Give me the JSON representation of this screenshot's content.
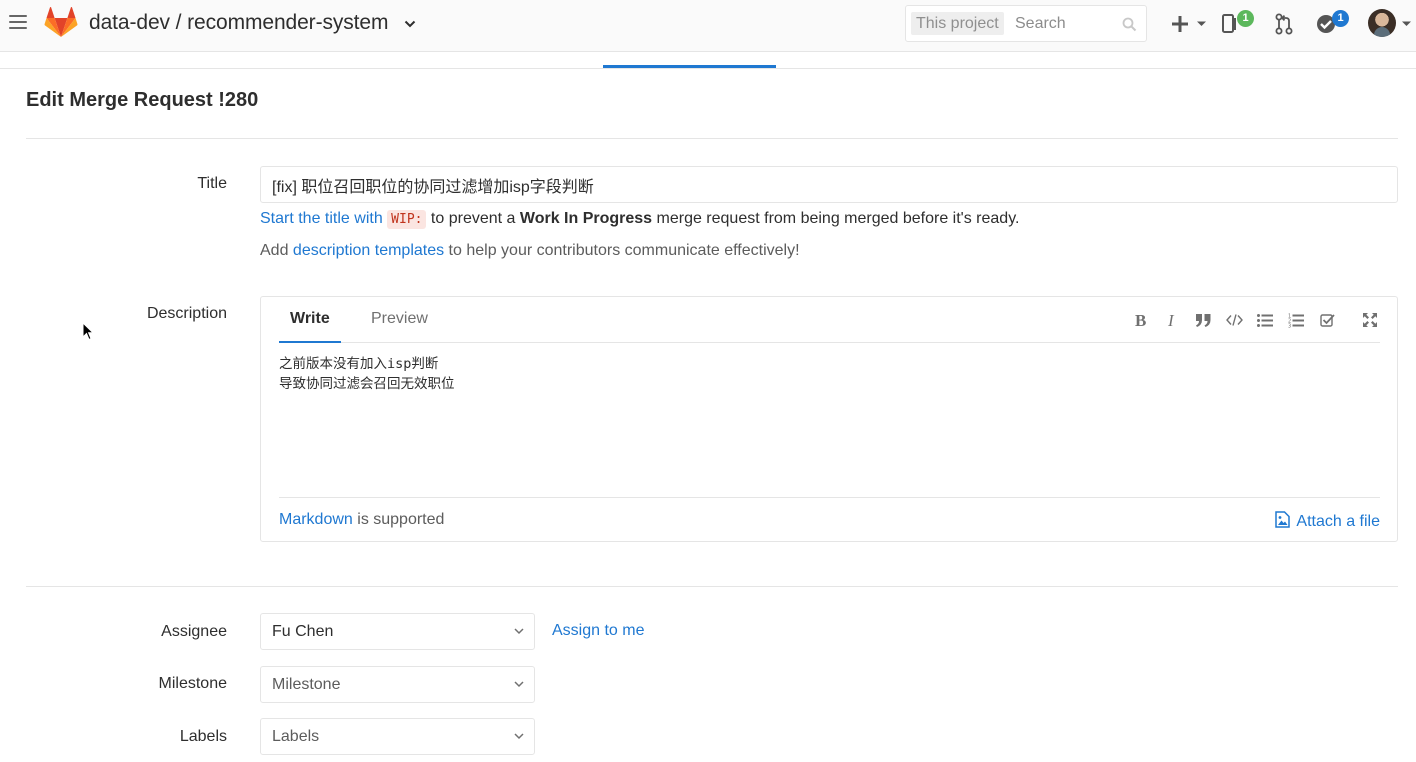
{
  "header": {
    "project_path": "data-dev / recommender-system",
    "search": {
      "scope": "This project",
      "placeholder": "Search"
    },
    "todo_badge": "1",
    "issues_badge": "1",
    "colors": {
      "issues_badge": "#5cb85c",
      "todo_badge": "#1f78d1",
      "accent": "#1f78d1"
    }
  },
  "page": {
    "title": "Edit Merge Request !280"
  },
  "form": {
    "title": {
      "label": "Title",
      "value": "[fix] 职位召回职位的协同过滤增加isp字段判断",
      "wip_hint": {
        "link": "Start the title with",
        "code": "WIP:",
        "before_bold": " to prevent a ",
        "bold": "Work In Progress",
        "after": " merge request from being merged before it's ready."
      },
      "template_hint": {
        "before": "Add ",
        "link": "description templates",
        "after": " to help your contributors communicate effectively!"
      }
    },
    "description": {
      "label": "Description",
      "tabs": {
        "write": "Write",
        "preview": "Preview"
      },
      "value": "之前版本没有加入isp判断\n导致协同过滤会召回无效职位",
      "markdown_link": "Markdown",
      "markdown_suffix": " is supported",
      "attach_label": "Attach a file"
    },
    "assignee": {
      "label": "Assignee",
      "value": "Fu Chen",
      "assign_to_me": "Assign to me"
    },
    "milestone": {
      "label": "Milestone",
      "placeholder": "Milestone"
    },
    "labels": {
      "label": "Labels",
      "placeholder": "Labels"
    }
  }
}
